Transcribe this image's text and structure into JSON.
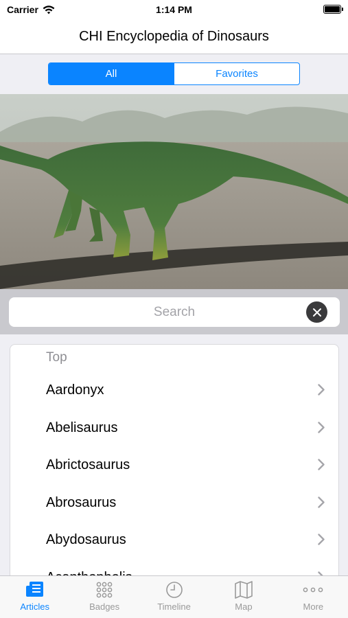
{
  "status": {
    "carrier": "Carrier",
    "time": "1:14 PM",
    "battery_level": 1.0
  },
  "nav": {
    "title": "CHI Encyclopedia of Dinosaurs"
  },
  "segments": [
    {
      "label": "All",
      "selected": true
    },
    {
      "label": "Favorites",
      "selected": false
    }
  ],
  "search": {
    "placeholder": "Search",
    "value": ""
  },
  "list": {
    "section_header": "Top",
    "items": [
      {
        "label": "Aardonyx"
      },
      {
        "label": "Abelisaurus"
      },
      {
        "label": "Abrictosaurus"
      },
      {
        "label": "Abrosaurus"
      },
      {
        "label": "Abydosaurus"
      },
      {
        "label": "Acanthopholis"
      }
    ]
  },
  "tabs": [
    {
      "label": "Articles",
      "icon": "articles-icon",
      "active": true
    },
    {
      "label": "Badges",
      "icon": "badges-grid-icon",
      "active": false
    },
    {
      "label": "Timeline",
      "icon": "clock-icon",
      "active": false
    },
    {
      "label": "Map",
      "icon": "map-icon",
      "active": false
    },
    {
      "label": "More",
      "icon": "more-dots-icon",
      "active": false
    }
  ],
  "colors": {
    "accent": "#0a84ff",
    "inactive_tab": "#999999",
    "background_gray": "#efeff4"
  }
}
